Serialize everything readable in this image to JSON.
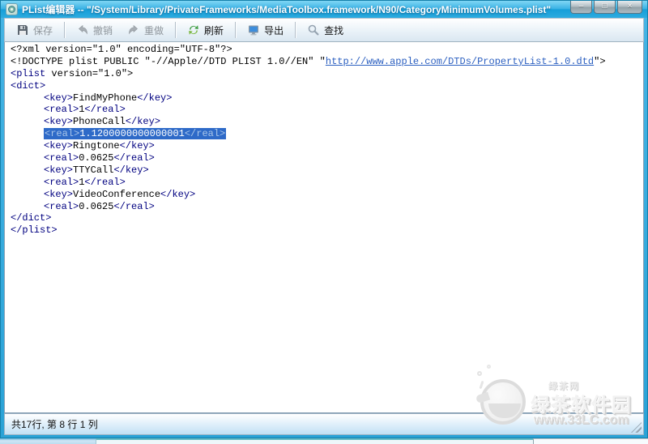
{
  "window": {
    "title": "PList编辑器 -- \"/System/Library/PrivateFrameworks/MediaToolbox.framework/N90/CategoryMinimumVolumes.plist\"",
    "controls": {
      "minimize": "–",
      "maximize": "□",
      "close": "×"
    }
  },
  "toolbar": {
    "buttons": [
      {
        "label": "保存",
        "icon": "save-icon",
        "enabled": false
      },
      {
        "label": "撤销",
        "icon": "undo-icon",
        "enabled": false
      },
      {
        "label": "重做",
        "icon": "redo-icon",
        "enabled": false
      },
      {
        "label": "刷新",
        "icon": "refresh-icon",
        "enabled": true
      },
      {
        "label": "导出",
        "icon": "export-icon",
        "enabled": true
      },
      {
        "label": "查找",
        "icon": "find-icon",
        "enabled": true
      }
    ]
  },
  "editor": {
    "selection_color": "#2e6ac8",
    "tag_color": "#000080",
    "link_color": "#2b5fc0",
    "lines": [
      {
        "segments": [
          {
            "c": "p",
            "t": "<?xml version=\"1.0\" encoding=\"UTF-8\"?>"
          }
        ]
      },
      {
        "segments": [
          {
            "c": "p",
            "t": "<!DOCTYPE plist PUBLIC \"-//Apple//DTD PLIST 1.0//EN\" \""
          },
          {
            "c": "u",
            "t": "http://www.apple.com/DTDs/PropertyList-1.0.dtd"
          },
          {
            "c": "p",
            "t": "\">"
          }
        ]
      },
      {
        "segments": [
          {
            "c": "t",
            "t": "<plist"
          },
          {
            "c": "p",
            "t": " version=\"1.0\">"
          }
        ]
      },
      {
        "segments": [
          {
            "c": "t",
            "t": "<dict>"
          }
        ]
      },
      {
        "indent": true,
        "segments": [
          {
            "c": "t",
            "t": "<key>"
          },
          {
            "c": "p",
            "t": "FindMyPhone"
          },
          {
            "c": "t",
            "t": "</key>"
          }
        ]
      },
      {
        "indent": true,
        "segments": [
          {
            "c": "t",
            "t": "<real>"
          },
          {
            "c": "p",
            "t": "1"
          },
          {
            "c": "t",
            "t": "</real>"
          }
        ]
      },
      {
        "indent": true,
        "segments": [
          {
            "c": "t",
            "t": "<key>"
          },
          {
            "c": "p",
            "t": "PhoneCall"
          },
          {
            "c": "t",
            "t": "</key>"
          }
        ]
      },
      {
        "indent": true,
        "selected": true,
        "segments": [
          {
            "c": "t",
            "t": "<real>"
          },
          {
            "c": "p",
            "t": "1.1200000000000001"
          },
          {
            "c": "t",
            "t": "</real>"
          }
        ]
      },
      {
        "indent": true,
        "segments": [
          {
            "c": "t",
            "t": "<key>"
          },
          {
            "c": "p",
            "t": "Ringtone"
          },
          {
            "c": "t",
            "t": "</key>"
          }
        ]
      },
      {
        "indent": true,
        "segments": [
          {
            "c": "t",
            "t": "<real>"
          },
          {
            "c": "p",
            "t": "0.0625"
          },
          {
            "c": "t",
            "t": "</real>"
          }
        ]
      },
      {
        "indent": true,
        "segments": [
          {
            "c": "t",
            "t": "<key>"
          },
          {
            "c": "p",
            "t": "TTYCall"
          },
          {
            "c": "t",
            "t": "</key>"
          }
        ]
      },
      {
        "indent": true,
        "segments": [
          {
            "c": "t",
            "t": "<real>"
          },
          {
            "c": "p",
            "t": "1"
          },
          {
            "c": "t",
            "t": "</real>"
          }
        ]
      },
      {
        "indent": true,
        "segments": [
          {
            "c": "t",
            "t": "<key>"
          },
          {
            "c": "p",
            "t": "VideoConference"
          },
          {
            "c": "t",
            "t": "</key>"
          }
        ]
      },
      {
        "indent": true,
        "segments": [
          {
            "c": "t",
            "t": "<real>"
          },
          {
            "c": "p",
            "t": "0.0625"
          },
          {
            "c": "t",
            "t": "</real>"
          }
        ]
      },
      {
        "segments": [
          {
            "c": "t",
            "t": "</dict>"
          }
        ]
      },
      {
        "segments": [
          {
            "c": "t",
            "t": "</plist>"
          }
        ]
      },
      {
        "segments": []
      }
    ]
  },
  "status": {
    "text": "共17行,  第 8 行 1 列"
  },
  "watermark": {
    "small": "绿茶网",
    "name": "绿茶软件园",
    "url": "www.33LC.com"
  }
}
